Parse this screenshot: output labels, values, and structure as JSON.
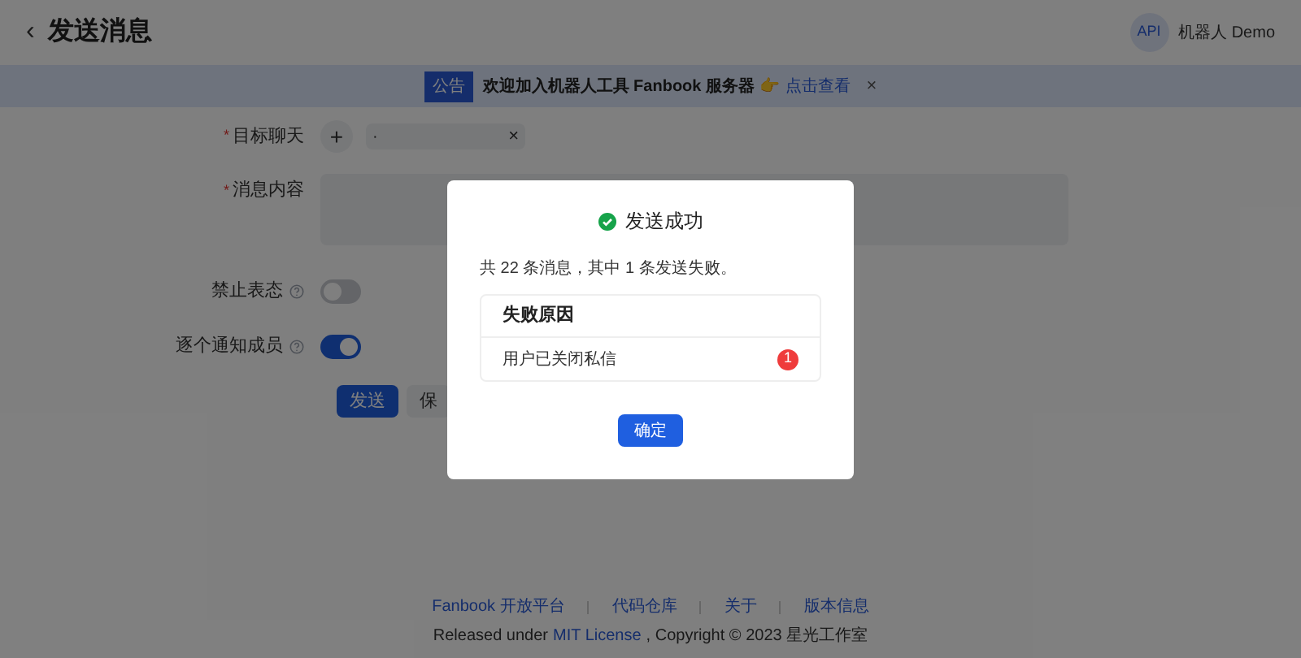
{
  "header": {
    "back": "‹",
    "title": "发送消息",
    "avatar": "API",
    "user": "机器人 Demo"
  },
  "notice": {
    "tag": "公告",
    "text": "欢迎加入机器人工具 Fanbook 服务器 👉",
    "link": "点击查看",
    "close": "×"
  },
  "form": {
    "fields": [
      {
        "kind": "target",
        "label": "目标聊天",
        "required_mark": "*",
        "add": "+",
        "chip": "·",
        "chip_close": "×"
      },
      {
        "kind": "textarea",
        "label": "消息内容",
        "required_mark": "*"
      },
      {
        "kind": "switch",
        "label": "禁止表态",
        "on": false
      },
      {
        "kind": "switch",
        "label": "逐个通知成员",
        "on": true
      }
    ],
    "buttons": [
      {
        "label": "发送",
        "primary": true
      },
      {
        "label": "保",
        "primary": false
      }
    ]
  },
  "dialog": {
    "title": "发送成功",
    "summary": "共 22 条消息，其中 1 条发送失败。",
    "table": {
      "header": "失败原因",
      "rows": [
        {
          "reason": "用户已关闭私信",
          "count": "1"
        }
      ]
    },
    "ok": "确定"
  },
  "footer": {
    "links": [
      "Fanbook 开放平台",
      "代码仓库",
      "关于",
      "版本信息"
    ],
    "copyright_before": "Released under",
    "license": "MIT License",
    "copyright_after": ", Copyright © 2023 星光工作室"
  }
}
